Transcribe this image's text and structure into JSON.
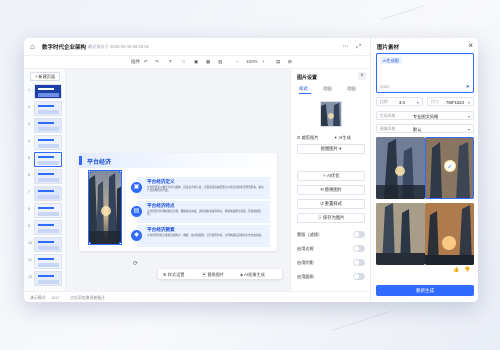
{
  "app": {
    "doc_title": "数字时代企业架构",
    "saved_status": "最近保存于 2025-05-16 08:25:52"
  },
  "toolbar": {
    "insert": "插件",
    "undo_icon": "undo-icon",
    "redo_icon": "redo-icon",
    "text_icon": "T",
    "zoom": "100%"
  },
  "left_rail": {
    "new_page": "+ 新建页面",
    "pages": [
      "1",
      "2",
      "3",
      "4",
      "5",
      "6",
      "7",
      "8",
      "9",
      "10",
      "11",
      "12"
    ]
  },
  "slide": {
    "title": "平台经济",
    "cards": [
      {
        "icon": "▣",
        "title": "平台经济定义",
        "body": "平台经济是以数字平台为载体，连接多方参与者，实现资源高效配置与价值共创的新型经济形态，推动产业结构优化升级。"
      },
      {
        "icon": "▤",
        "title": "平台经济特点",
        "body": "平台经济具有网络效应显著、数据驱动决策、边际成本递减等特点，能够快速整合资源，形成规模优势。"
      },
      {
        "icon": "◆",
        "title": "平台经济要素",
        "body": "平台经济的核心要素包括用户、数据、技术和规则，它们相互作用，共同构建起完整的平台生态系统。"
      }
    ]
  },
  "image_actions": [
    "样式设置",
    "替换图片",
    "AI抠像生成"
  ],
  "props_panel": {
    "title": "图片设置",
    "tabs": [
      "样式",
      "动画",
      "动画"
    ],
    "btn_crop": "裁剪图片",
    "btn_ai": "AI生成",
    "btn_matting": "抠图图片",
    "btn_style": "AI优化",
    "btn_replace": "替换图片",
    "btn_reset": "重置样式",
    "btn_save": "保存为图片",
    "toggles": [
      "蒙版（滤镜）",
      "启用边框",
      "启用阴影",
      "启用圆角"
    ]
  },
  "material_panel": {
    "title": "图片素材",
    "chip": "AI生成图",
    "char_count": "0/500",
    "ratio_label": "比例",
    "ratio_value": "3:4",
    "size_label": "尺寸",
    "size_value": "768*1024",
    "style_label": "生成风格",
    "style_value": "专业图文风格",
    "color_label": "图像风格",
    "color_value": "默认",
    "regenerate": "重新生成"
  },
  "statusbar": {
    "left": "演示模式",
    "mid": "5/17",
    "right": "点击添加演讲者备注"
  },
  "colors": {
    "accent": "#2f6bff",
    "accent_dark": "#1e4fd8",
    "card_bg": "#eaf1ff"
  }
}
